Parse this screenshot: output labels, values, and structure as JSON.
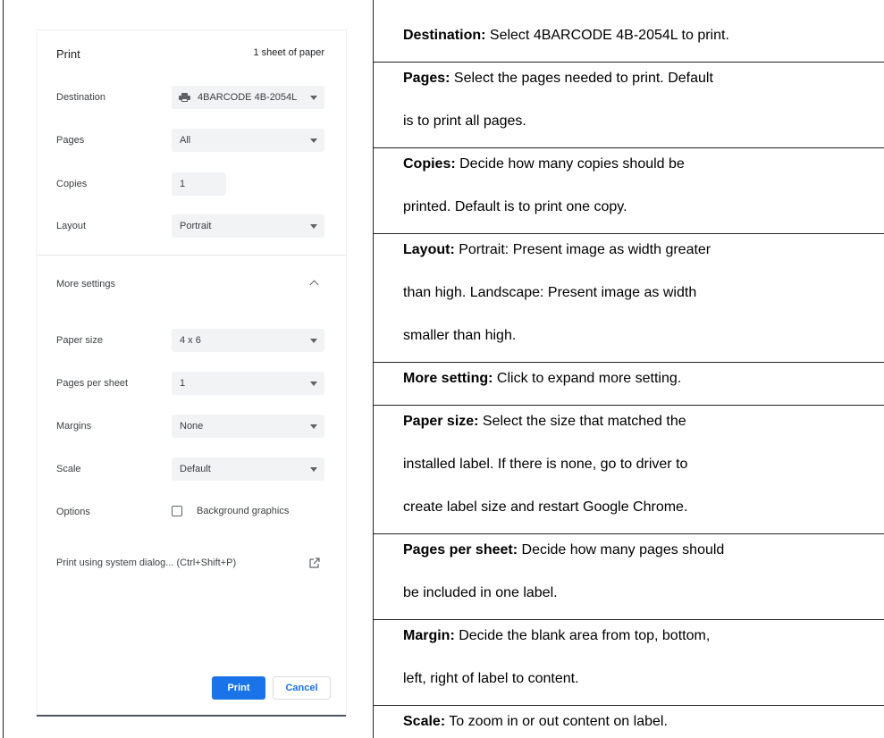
{
  "dialog": {
    "title": "Print",
    "sheet_count": "1 sheet of paper",
    "destination": {
      "label": "Destination",
      "value": "4BARCODE 4B-2054L",
      "icon": "printer-icon"
    },
    "pages": {
      "label": "Pages",
      "value": "All"
    },
    "copies": {
      "label": "Copies",
      "value": "1"
    },
    "layout": {
      "label": "Layout",
      "value": "Portrait"
    },
    "more_settings": {
      "label": "More settings",
      "icon": "chevron-up-icon",
      "expanded": true
    },
    "paper_size": {
      "label": "Paper size",
      "value": "4 x 6"
    },
    "pages_per_sheet": {
      "label": "Pages per sheet",
      "value": "1"
    },
    "margins": {
      "label": "Margins",
      "value": "None"
    },
    "scale": {
      "label": "Scale",
      "value": "Default"
    },
    "options": {
      "label": "Options",
      "checkbox_label": "Background graphics",
      "checked": false
    },
    "system_dialog": {
      "label": "Print using system dialog... (Ctrl+Shift+P)",
      "icon": "open-in-new-icon"
    },
    "print_button": "Print",
    "cancel_button": "Cancel",
    "colors": {
      "accent": "#1a73e8",
      "field_bg": "#f1f3f4"
    }
  },
  "descriptions": [
    {
      "title": "Destination:",
      "lines": [
        " Select 4BARCODE 4B-2054L to print."
      ]
    },
    {
      "title": "Pages:",
      "lines": [
        " Select the pages needed to print. Default",
        "is to print all pages."
      ]
    },
    {
      "title": "Copies:",
      "lines": [
        " Decide how many copies should be",
        "printed. Default is to print one copy."
      ]
    },
    {
      "title": "Layout:",
      "lines": [
        " Portrait: Present image as width greater",
        "than high. Landscape: Present image as width",
        "smaller than high."
      ]
    },
    {
      "title": "More setting:",
      "lines": [
        " Click to expand more setting."
      ]
    },
    {
      "title": "Paper size:",
      "lines": [
        " Select the size that matched the",
        "installed label. If there is none, go to driver to",
        "create label size and restart Google Chrome."
      ]
    },
    {
      "title": "Pages per sheet:",
      "lines": [
        " Decide how many pages should",
        "be included in one label."
      ]
    },
    {
      "title": "Margin:",
      "lines": [
        " Decide the blank area from top, bottom,",
        "left, right of label to content."
      ]
    },
    {
      "title": "Scale:",
      "lines": [
        " To zoom in or out content on label."
      ]
    }
  ]
}
